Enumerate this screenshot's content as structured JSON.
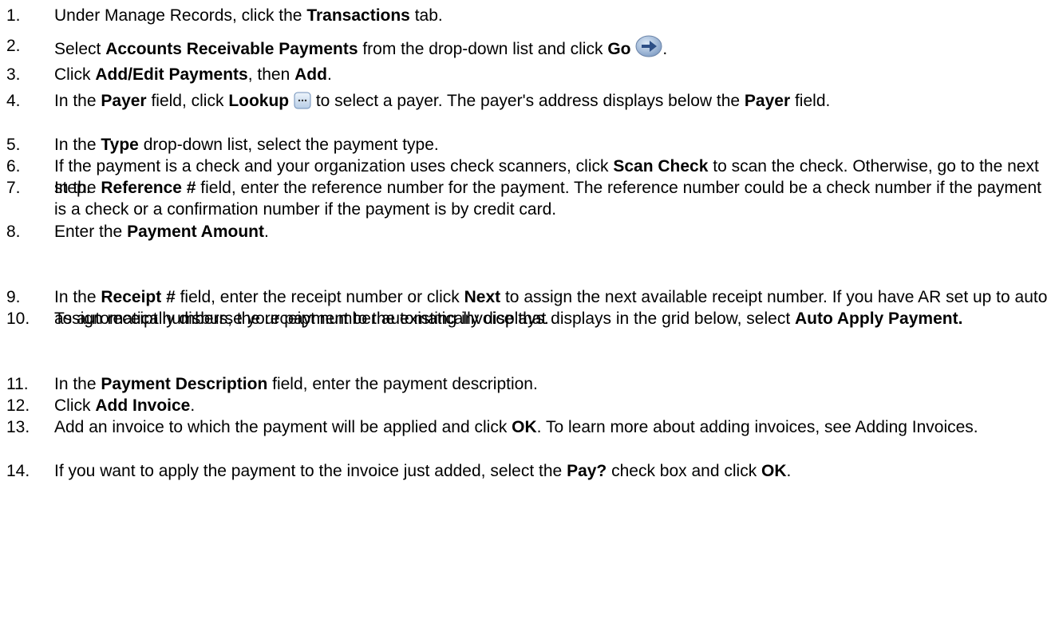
{
  "steps": [
    {
      "num": "1.",
      "parts": [
        {
          "t": "Under Manage Records, click the "
        },
        {
          "b": "Transactions"
        },
        {
          "t": " tab."
        }
      ]
    },
    {
      "num": "2.",
      "parts": [
        {
          "t": "Select "
        },
        {
          "b": "Accounts Receivable Payments"
        },
        {
          "t": " from the drop-down list and click "
        },
        {
          "b": "Go"
        },
        {
          "t": " "
        },
        {
          "icon": "go-arrow-icon"
        },
        {
          "t": "."
        }
      ]
    },
    {
      "num": "3.",
      "parts": [
        {
          "t": "Click "
        },
        {
          "b": "Add/Edit Payments"
        },
        {
          "t": ", then "
        },
        {
          "b": "Add"
        },
        {
          "t": "."
        }
      ]
    },
    {
      "num": "4.",
      "parts": [
        {
          "t": "In the "
        },
        {
          "b": "Payer"
        },
        {
          "t": " field, click "
        },
        {
          "b": "Lookup"
        },
        {
          "t": " "
        },
        {
          "icon": "lookup-icon"
        },
        {
          "t": " to select a payer. The payer's address displays below the "
        },
        {
          "b": "Payer"
        },
        {
          "t": " field."
        }
      ]
    },
    {
      "num": "5.",
      "parts": [
        {
          "t": "In the "
        },
        {
          "b": "Type"
        },
        {
          "t": " drop-down list, select the payment type."
        }
      ]
    },
    {
      "num": "6.",
      "parts": [
        {
          "t": "If the payment is a check and your organization uses check scanners, click "
        },
        {
          "b": "Scan Check"
        },
        {
          "t": " to scan the check. Otherwise, go to the next step."
        }
      ]
    },
    {
      "num": "7.",
      "parts": [
        {
          "t": "In the "
        },
        {
          "b": "Reference #"
        },
        {
          "t": " field, enter the reference number for the payment. The reference number could be a check number if the payment is a check or a confirmation number if the payment is by credit card."
        }
      ]
    },
    {
      "num": "8.",
      "parts": [
        {
          "t": "Enter the "
        },
        {
          "b": "Payment Amount"
        },
        {
          "t": "."
        }
      ]
    },
    {
      "num": "9.",
      "parts": [
        {
          "t": "In the "
        },
        {
          "b": "Receipt #"
        },
        {
          "t": " field, enter the receipt number or click "
        },
        {
          "b": "Next"
        },
        {
          "t": " to assign the next available receipt number. If you have AR set up to auto assign receipt numbers, the receipt number automatically displays."
        }
      ]
    },
    {
      "num": "10.",
      "parts": [
        {
          "t": "To automatically disburse your payment to the existing invoice that displays in the grid below, select "
        },
        {
          "b": "Auto Apply Payment."
        }
      ]
    },
    {
      "num": "11.",
      "parts": [
        {
          "t": "In the "
        },
        {
          "b": "Payment Description"
        },
        {
          "t": " field, enter the payment description."
        }
      ]
    },
    {
      "num": "12.",
      "parts": [
        {
          "t": "Click "
        },
        {
          "b": "Add Invoice"
        },
        {
          "t": "."
        }
      ]
    },
    {
      "num": "13.",
      "parts": [
        {
          "t": "Add an invoice to which the payment will be applied and click "
        },
        {
          "b": "OK"
        },
        {
          "t": ". To learn more about adding invoices, see Adding Invoices."
        }
      ]
    },
    {
      "num": "14.",
      "parts": [
        {
          "t": "If you want to apply the payment to the invoice just added, select the "
        },
        {
          "b": "Pay?"
        },
        {
          "t": " check box and click "
        },
        {
          "b": "OK"
        },
        {
          "t": "."
        }
      ]
    }
  ]
}
